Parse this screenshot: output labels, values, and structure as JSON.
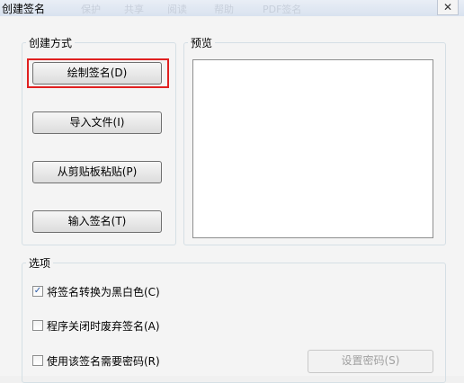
{
  "window": {
    "title": "创建签名",
    "close_glyph": "✕",
    "ghost_menu": [
      "保护",
      "共享",
      "阅读",
      "帮助",
      "PDF签名"
    ]
  },
  "create_group": {
    "legend": "创建方式",
    "buttons": [
      {
        "label": "绘制签名(D)",
        "highlighted": true
      },
      {
        "label": "导入文件(I)"
      },
      {
        "label": "从剪贴板粘贴(P)"
      },
      {
        "label": "输入签名(T)"
      }
    ]
  },
  "preview_group": {
    "legend": "预览"
  },
  "options_group": {
    "legend": "选项",
    "checkboxes": [
      {
        "label": "将签名转换为黑白色(C)",
        "checked": true
      },
      {
        "label": "程序关闭时废弃签名(A)",
        "checked": false
      },
      {
        "label": "使用该签名需要密码(R)",
        "checked": false
      }
    ],
    "set_password_button": "设置密码(S)"
  },
  "colors": {
    "highlight": "#e02020",
    "check": "#2a5ba8"
  }
}
